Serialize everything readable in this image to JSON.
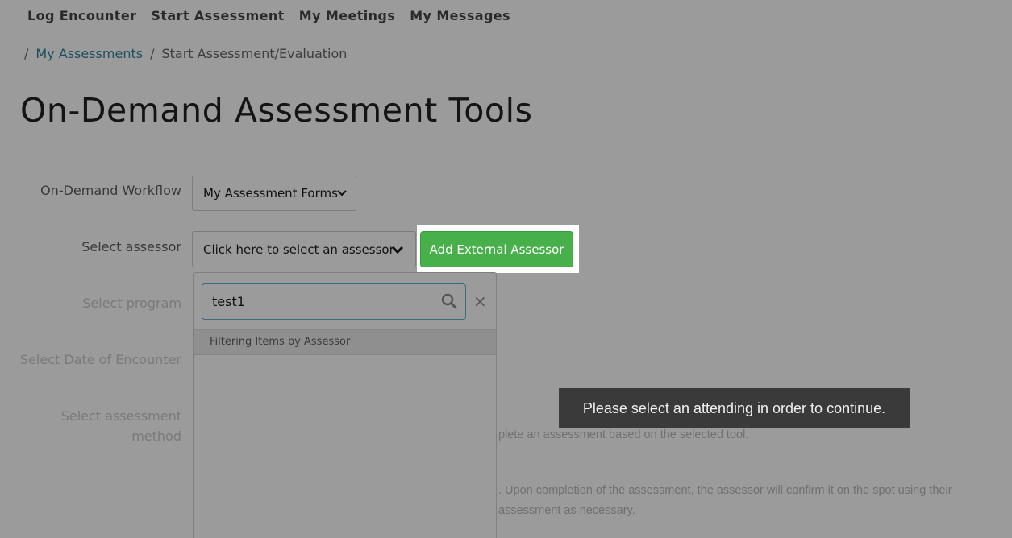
{
  "nav": {
    "items": [
      {
        "label": "Log Encounter"
      },
      {
        "label": "Start Assessment"
      },
      {
        "label": "My Meetings"
      },
      {
        "label": "My Messages"
      }
    ]
  },
  "breadcrumb": {
    "separator": "/",
    "link": "My Assessments",
    "current": "Start Assessment/Evaluation"
  },
  "page": {
    "title": "On-Demand Assessment Tools"
  },
  "form": {
    "workflow_label": "On-Demand Workflow",
    "workflow_value": "My Assessment Forms",
    "assessor_label": "Select assessor",
    "assessor_placeholder": "Click here to select an assessor",
    "add_external_label": "Add External Assessor",
    "program_label": "Select program",
    "date_label": "Select Date of Encounter",
    "method_label_line1": "Select assessment",
    "method_label_line2": "method"
  },
  "dropdown": {
    "search_value": "test1",
    "clear_symbol": "×",
    "filter_header": "Filtering Items by Assessor"
  },
  "toast": {
    "message": "Please select an attending in order to continue."
  },
  "descriptions": {
    "line1": "plete an assessment based on the selected tool.",
    "line2": ". Upon completion of the assessment, the assessor will confirm it on the spot using their",
    "line3": "assessment as necessary."
  },
  "colors": {
    "overlay_bg": "#9b9b9b",
    "primary_green": "#47b04b",
    "link_teal": "#1e4f5d",
    "toast_bg": "#3a3a3a",
    "nav_rule": "#8e7c3a"
  }
}
